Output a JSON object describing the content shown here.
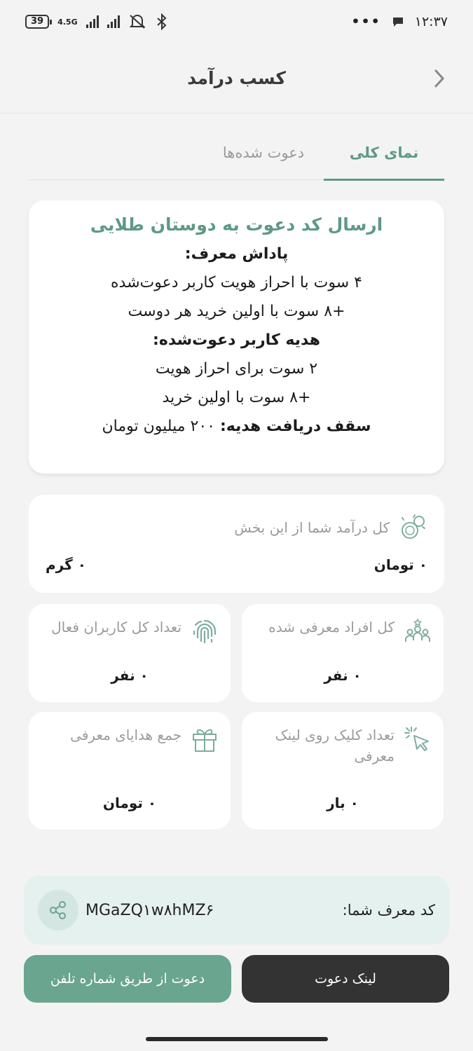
{
  "status_bar": {
    "battery": "39",
    "network": "4.5G",
    "time": "۱۲:۳۷",
    "dots": "•••"
  },
  "header": {
    "title": "کسب درآمد",
    "back_icon": "chevron-right-icon"
  },
  "tabs": [
    {
      "label": "نمای کلی",
      "active": true
    },
    {
      "label": "دعوت شده‌ها",
      "active": false
    }
  ],
  "invite": {
    "title": "ارسال کد دعوت به دوستان طلایی",
    "referrer_reward_heading": "پاداش معرف:",
    "referrer_line_1": "۴ سوت با احراز هویت کاربر دعوت‌شده",
    "referrer_line_2": "+۸ سوت با اولین خرید هر دوست",
    "invitee_gift_heading": "هدیه کاربر دعوت‌شده:",
    "invitee_line_1": "۲ سوت برای احراز هویت",
    "invitee_line_2": "+۸ سوت با اولین خرید",
    "cap_label": "سقف دریافت هدیه:",
    "cap_value": "۲۰۰ میلیون تومان"
  },
  "stats": {
    "income": {
      "label": "کل درآمد شما از این بخش",
      "value_toman": "۰ تومان",
      "value_gram": "۰ گرم",
      "icon": "coins-icon"
    },
    "referred": {
      "label": "کل افراد معرفی شده",
      "value": "۰ نفر",
      "icon": "people-group-icon"
    },
    "active_users": {
      "label": "تعداد کل کاربران فعال",
      "value": "۰ نفر",
      "icon": "fingerprint-icon"
    },
    "link_clicks": {
      "label": "تعداد کلیک روی لینک معرفی",
      "value": "۰ بار",
      "icon": "cursor-click-icon"
    },
    "gifts_total": {
      "label": "جمع هدایای معرفی",
      "value": "۰ تومان",
      "icon": "gift-icon"
    }
  },
  "referral": {
    "label": "کد معرف شما:",
    "code": "MGaZQ۱w۸hMZ۶",
    "share_icon": "share-icon"
  },
  "buttons": {
    "invite_link": "لینک دعوت",
    "invite_phone": "دعوت از طریق شماره تلفن"
  },
  "colors": {
    "accent": "#5e9a84",
    "button_green": "#6aa58f",
    "button_dark": "#333333",
    "referral_bg": "#e4f1ef"
  }
}
